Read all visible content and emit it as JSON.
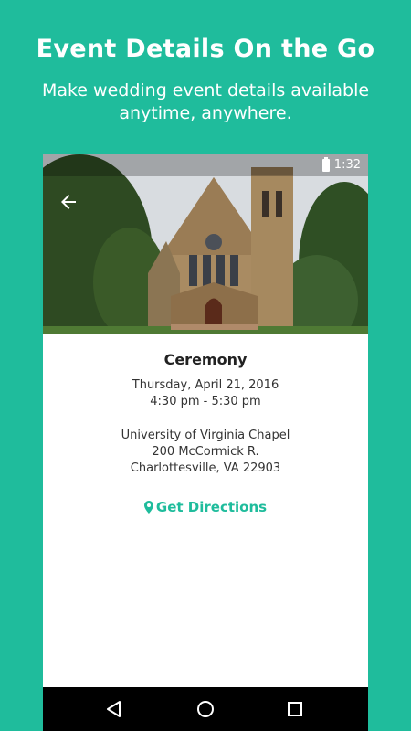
{
  "promo": {
    "title": "Event Details On the Go",
    "subtitle": "Make wedding event details available anytime, anywhere."
  },
  "status_bar": {
    "time": "1:32"
  },
  "event": {
    "name": "Ceremony",
    "date": "Thursday, April 21, 2016",
    "time_range": "4:30 pm - 5:30 pm",
    "venue": "University of Virginia Chapel",
    "address_line1": "200 McCormick R.",
    "address_line2": "Charlottesville, VA 22903",
    "directions_label": "Get Directions"
  },
  "colors": {
    "accent": "#1fbc9c",
    "background": "#1fbc9c"
  },
  "icons": {
    "back": "back-arrow-icon",
    "directions": "map-pin-icon",
    "nav_back": "triangle-back-icon",
    "nav_home": "circle-home-icon",
    "nav_recents": "square-recents-icon"
  }
}
